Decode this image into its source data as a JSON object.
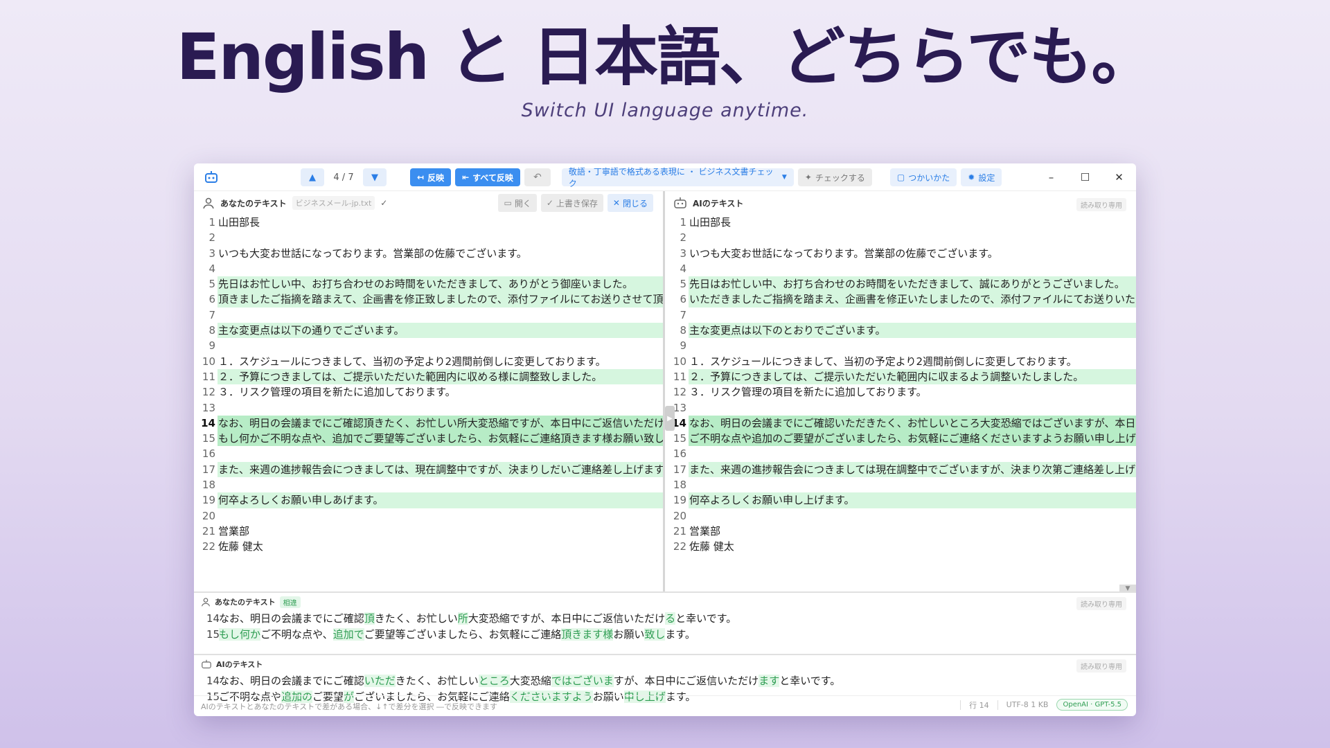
{
  "hero": {
    "title": "English と 日本語、どちらでも。",
    "subtitle": "Switch UI language anytime."
  },
  "toolbar": {
    "nav_count": "4 / 7",
    "apply_label": "反映",
    "apply_all_label": "すべて反映",
    "mode_label": "敬語・丁寧語で格式ある表現に ・ ビジネス文書チェック",
    "check_label": "チェックする",
    "howto_label": "つかいかた",
    "settings_label": "設定"
  },
  "left_pane": {
    "title": "あなたのテキスト",
    "file": "ビジネスメール-jp.txt",
    "open_label": "開く",
    "save_label": "上書き保存",
    "close_label": "閉じる",
    "lines": [
      "山田部長",
      "",
      "いつも大変お世話になっております。営業部の佐藤でございます。",
      "",
      "先日はお忙しい中、お打ち合わせのお時間をいただきまして、ありがとう御座いました。",
      "頂きましたご指摘を踏まえて、企画書を修正致しましたので、添付ファイルにてお送りさせて頂きます。",
      "",
      "主な変更点は以下の通りでございます。",
      "",
      "１．スケジュールにつきまして、当初の予定より2週間前倒しに変更しております。",
      "２．予算につきましては、ご提示いただいた範囲内に収める様に調整致しました。",
      "３．リスク管理の項目を新たに追加しております。",
      "",
      "なお、明日の会議までにご確認頂きたく、お忙しい所大変恐縮ですが、本日中にご返信いただけると幸いです。",
      "もし何かご不明な点や、追加でご要望等ございましたら、お気軽にご連絡頂きます様お願い致します。",
      "",
      "また、来週の進捗報告会につきましては、現在調整中ですが、決まりしだいご連絡差し上げます。",
      "",
      "何卒よろしくお願い申しあげます。",
      "",
      "営業部",
      "佐藤 健太"
    ]
  },
  "right_pane": {
    "title": "AIのテキスト",
    "readonly": "読み取り専用",
    "lines": [
      "山田部長",
      "",
      "いつも大変お世話になっております。営業部の佐藤でございます。",
      "",
      "先日はお忙しい中、お打ち合わせのお時間をいただきまして、誠にありがとうございました。",
      "いただきましたご指摘を踏まえ、企画書を修正いたしましたので、添付ファイルにてお送りいたします。",
      "",
      "主な変更点は以下のとおりでございます。",
      "",
      "１．スケジュールにつきまして、当初の予定より2週間前倒しに変更しております。",
      "２．予算につきましては、ご提示いただいた範囲内に収まるよう調整いたしました。",
      "３．リスク管理の項目を新たに追加しております。",
      "",
      "なお、明日の会議までにご確認いただきたく、お忙しいところ大変恐縮ではございますが、本日中にご返信いただけますと幸いです。",
      "ご不明な点や追加のご要望がございましたら、お気軽にご連絡くださいますようお願い申し上げます。",
      "",
      "また、来週の進捗報告会につきましては現在調整中でございますが、決まり次第ご連絡差し上げます。",
      "",
      "何卒よろしくお願い申し上げます。",
      "",
      "営業部",
      "佐藤 健太"
    ]
  },
  "diff_user": {
    "title": "あなたのテキスト",
    "tag": "相違",
    "readonly": "読み取り専用",
    "line14_num": "14",
    "line15_num": "15",
    "line14": [
      [
        "なお、明日の会議までにご確認",
        0
      ],
      [
        "頂",
        1
      ],
      [
        "きたく、お忙しい",
        0
      ],
      [
        "所",
        1
      ],
      [
        "大変恐縮ですが、本日中にご返信いただけ",
        0
      ],
      [
        "る",
        1
      ],
      [
        "と幸いです。",
        0
      ]
    ],
    "line15": [
      [
        "もし何か",
        1
      ],
      [
        "ご不明な点や、",
        0
      ],
      [
        "追加で",
        1
      ],
      [
        "ご要望等ございましたら、お気軽にご連絡",
        0
      ],
      [
        "頂きます様",
        1
      ],
      [
        "お願い",
        0
      ],
      [
        "致し",
        1
      ],
      [
        "ます。",
        0
      ]
    ]
  },
  "diff_ai": {
    "title": "AIのテキスト",
    "readonly": "読み取り専用",
    "line14_num": "14",
    "line15_num": "15",
    "line14": [
      [
        "なお、明日の会議までにご確認",
        0
      ],
      [
        "いただ",
        1
      ],
      [
        "きたく、お忙しい",
        0
      ],
      [
        "ところ",
        1
      ],
      [
        "大変恐縮",
        0
      ],
      [
        "ではございま",
        1
      ],
      [
        "すが、本日中にご返信いただけ",
        0
      ],
      [
        "ます",
        1
      ],
      [
        "と幸いです。",
        0
      ]
    ],
    "line15": [
      [
        "ご不明な点や",
        0
      ],
      [
        "追加の",
        1
      ],
      [
        "ご要望",
        0
      ],
      [
        "が",
        1
      ],
      [
        "ございましたら、お気軽にご連絡",
        0
      ],
      [
        "くださいますよう",
        1
      ],
      [
        "お願い",
        0
      ],
      [
        "申し上げ",
        1
      ],
      [
        "ます。",
        0
      ]
    ]
  },
  "status": {
    "hint": "AIのテキストとあなたのテキストで差がある場合、↓↑で差分を選択 ―で反映できます",
    "line": "行 14",
    "encoding": "UTF-8 1 KB",
    "model": "OpenAI · GPT-5.5"
  },
  "colors": {
    "accent": "#3b8ef0",
    "diff_green": "#d6f6df",
    "title_purple": "#2a1b52"
  }
}
